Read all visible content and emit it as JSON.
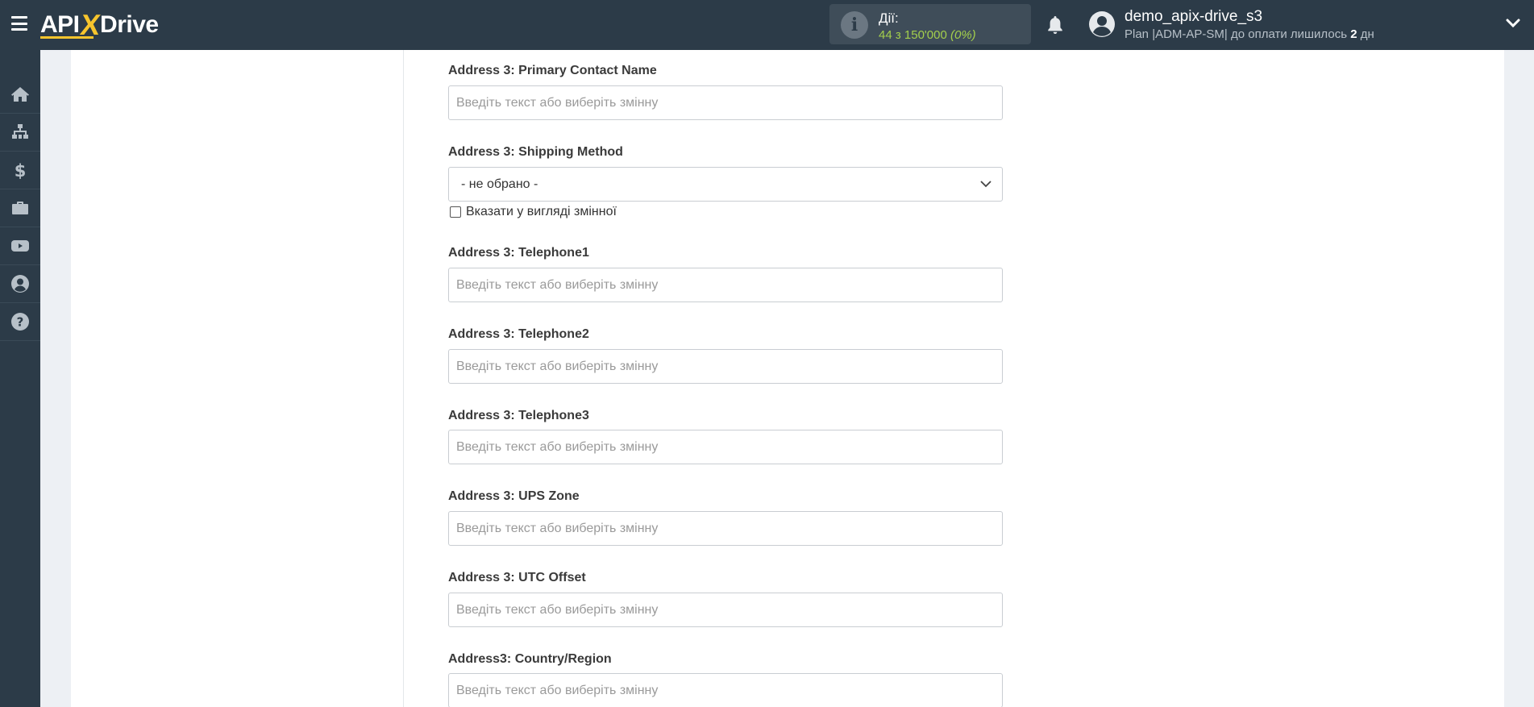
{
  "header": {
    "logo": {
      "part1": "API",
      "x": "X",
      "part2": "Drive"
    },
    "actions": {
      "label": "Дії:",
      "count": "44 з 150'000",
      "percent": "(0%)"
    },
    "user": {
      "name": "demo_apix-drive_s3",
      "plan_prefix": "Plan |ADM-AP-SM| до оплати лишилось ",
      "days": "2",
      "plan_suffix": " дн"
    }
  },
  "sidebar": {
    "items": [
      {
        "icon": "home-icon"
      },
      {
        "icon": "sitemap-icon"
      },
      {
        "icon": "dollar-icon"
      },
      {
        "icon": "briefcase-icon"
      },
      {
        "icon": "youtube-icon"
      },
      {
        "icon": "user-icon"
      },
      {
        "icon": "help-icon"
      }
    ]
  },
  "form": {
    "fields": [
      {
        "label": "Address 3: Primary Contact Name",
        "type": "text",
        "placeholder": "Введіть текст або виберіть змінну"
      },
      {
        "label": "Address 3: Shipping Method",
        "type": "select",
        "value": "- не обрано -",
        "checkbox_label": "Вказати у вигляді змінної"
      },
      {
        "label": "Address 3: Telephone1",
        "type": "text",
        "placeholder": "Введіть текст або виберіть змінну"
      },
      {
        "label": "Address 3: Telephone2",
        "type": "text",
        "placeholder": "Введіть текст або виберіть змінну"
      },
      {
        "label": "Address 3: Telephone3",
        "type": "text",
        "placeholder": "Введіть текст або виберіть змінну"
      },
      {
        "label": "Address 3: UPS Zone",
        "type": "text",
        "placeholder": "Введіть текст або виберіть змінну"
      },
      {
        "label": "Address 3: UTC Offset",
        "type": "text",
        "placeholder": "Введіть текст або виберіть змінну"
      },
      {
        "label": "Address3: Country/Region",
        "type": "text",
        "placeholder": "Введіть текст або виберіть змінну"
      }
    ]
  }
}
